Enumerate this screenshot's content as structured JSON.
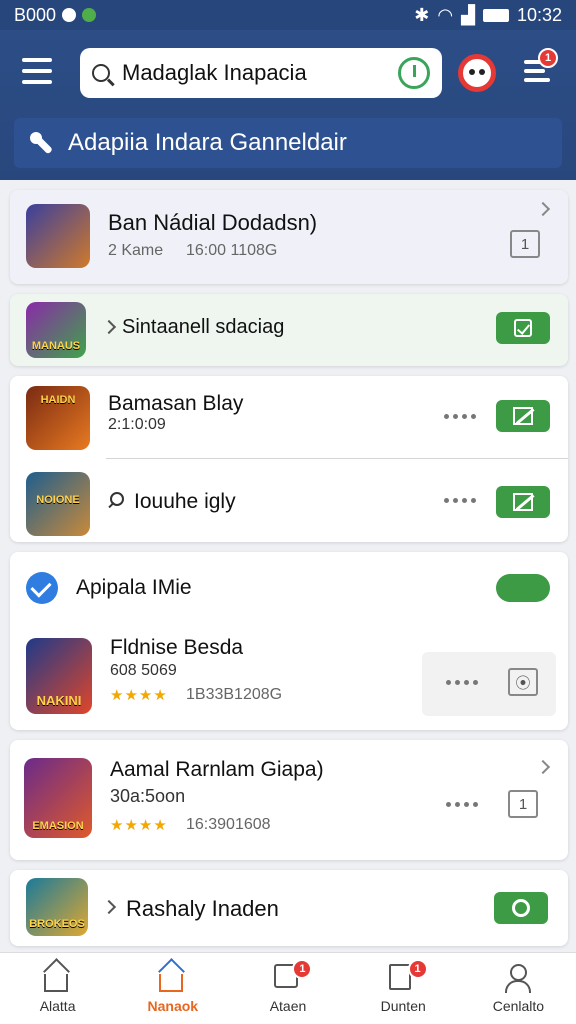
{
  "status_bar": {
    "left_text": "B000",
    "time": "10:32"
  },
  "search": {
    "value": "Madaglak Inapacia"
  },
  "header": {
    "banner_text": "Adapiia Indara Ganneldair",
    "notification_count": "1"
  },
  "cards": [
    {
      "title": "Ban Nádial Dodadsn)",
      "sub_left": "2 Kame",
      "sub_right": "16:00 1108G",
      "count": "1",
      "thumb_text": "",
      "thumb_colors": [
        "#3a3f9e",
        "#d07a2a"
      ]
    },
    {
      "title": "Sintaanell sdaciag",
      "thumb_text": "MANAUS",
      "thumb_colors": [
        "#8a2aa8",
        "#3fa44a"
      ]
    },
    {
      "title": "Bamasan Blay",
      "sub": "2:1:0:09",
      "thumb_text": "HAIDN",
      "thumb_colors": [
        "#7a2a12",
        "#e87a22"
      ]
    },
    {
      "title": "Iouuhe igly",
      "thumb_text": "NOIONE",
      "thumb_colors": [
        "#1e5e8e",
        "#c98a3a"
      ]
    }
  ],
  "section": {
    "title": "Apipala IMie"
  },
  "feature": {
    "title": "Fldnise Besda",
    "sub": "608 5069",
    "stars": "★★★★",
    "meta": "1B33B1208G",
    "thumb_text": "NAKINI",
    "thumb_colors": [
      "#1e3a8a",
      "#e0462a"
    ]
  },
  "card6": {
    "title": "Aamal Rarnlam Giapa)",
    "sub": "30a:5oon",
    "stars": "★★★★",
    "meta": "16:3901608",
    "count": "1",
    "thumb_text": "EMASION",
    "thumb_colors": [
      "#6a2a8a",
      "#e05a2a"
    ]
  },
  "card7": {
    "title": "Rashaly Inaden",
    "thumb_text": "BROKEOS",
    "thumb_colors": [
      "#1a7a9a",
      "#e0a830"
    ]
  },
  "nav": [
    {
      "label": "Alatta"
    },
    {
      "label": "Nanaok"
    },
    {
      "label": "Ataen",
      "badge": "1"
    },
    {
      "label": "Dunten",
      "badge": "1"
    },
    {
      "label": "Cenlalto"
    }
  ],
  "colors": {
    "header_bg": "#28477d",
    "accent_green": "#3d9a45",
    "active_orange": "#e8661e",
    "badge_red": "#e53935"
  }
}
